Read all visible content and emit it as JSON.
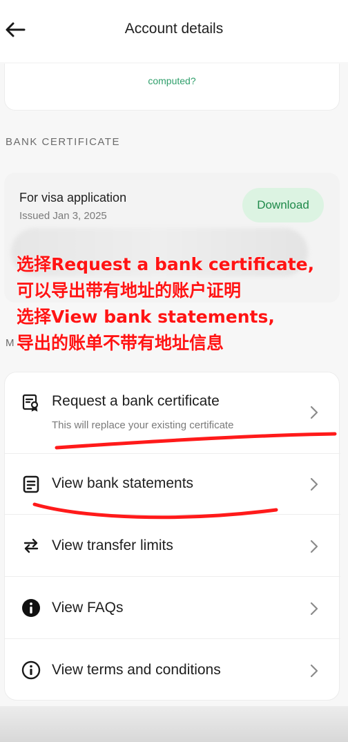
{
  "header": {
    "title": "Account details"
  },
  "top_card": {
    "text": "computed?"
  },
  "bank_certificate": {
    "section_label": "BANK CERTIFICATE",
    "title": "For visa application",
    "issued": "Issued Jan 3, 2025",
    "download_label": "Download"
  },
  "annotation": {
    "lines": [
      "选择Request a bank certificate,",
      "可以导出带有地址的账户证明",
      "选择View bank statements,",
      "导出的账单不带有地址信息"
    ]
  },
  "more_section": {
    "label": "M"
  },
  "menu": {
    "items": [
      {
        "label": "Request a bank certificate",
        "subtitle": "This will replace your existing certificate",
        "icon": "certificate-icon"
      },
      {
        "label": "View bank statements",
        "icon": "statement-icon"
      },
      {
        "label": "View transfer limits",
        "icon": "transfer-arrows-icon"
      },
      {
        "label": "View FAQs",
        "icon": "info-filled-icon"
      },
      {
        "label": "View terms and conditions",
        "icon": "info-outline-icon"
      }
    ]
  },
  "colors": {
    "accent_green": "#1f8a4a",
    "annotation_red": "#ff1414"
  }
}
